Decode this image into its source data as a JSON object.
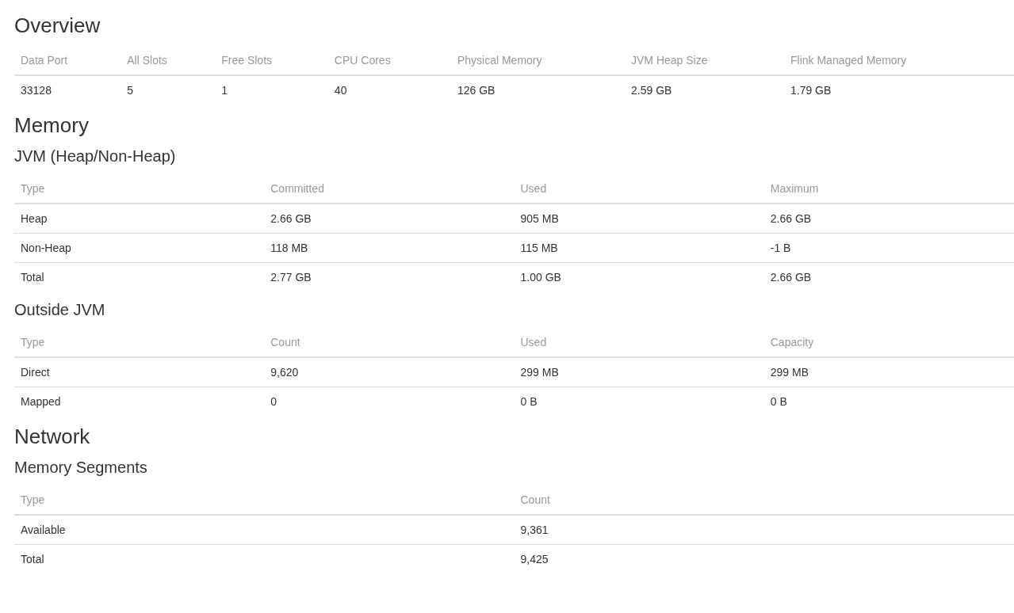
{
  "overview": {
    "title": "Overview",
    "table": {
      "columns": [
        "Data Port",
        "All Slots",
        "Free Slots",
        "CPU Cores",
        "Physical Memory",
        "JVM Heap Size",
        "Flink Managed Memory"
      ],
      "rows": [
        [
          "33128",
          "5",
          "1",
          "40",
          "126 GB",
          "2.59 GB",
          "1.79 GB"
        ]
      ]
    }
  },
  "memory": {
    "title": "Memory",
    "jvm": {
      "title": "JVM (Heap/Non-Heap)",
      "table": {
        "columns": [
          "Type",
          "Committed",
          "Used",
          "Maximum"
        ],
        "rows": [
          [
            "Heap",
            "2.66 GB",
            "905 MB",
            "2.66 GB"
          ],
          [
            "Non-Heap",
            "118 MB",
            "115 MB",
            "-1 B"
          ],
          [
            "Total",
            "2.77 GB",
            "1.00 GB",
            "2.66 GB"
          ]
        ]
      }
    },
    "outside_jvm": {
      "title": "Outside JVM",
      "table": {
        "columns": [
          "Type",
          "Count",
          "Used",
          "Capacity"
        ],
        "rows": [
          [
            "Direct",
            "9,620",
            "299 MB",
            "299 MB"
          ],
          [
            "Mapped",
            "0",
            "0 B",
            "0 B"
          ]
        ]
      }
    }
  },
  "network": {
    "title": "Network",
    "memory_segments": {
      "title": "Memory Segments",
      "table": {
        "columns": [
          "Type",
          "Count"
        ],
        "rows": [
          [
            "Available",
            "9,361"
          ],
          [
            "Total",
            "9,425"
          ]
        ]
      }
    }
  }
}
